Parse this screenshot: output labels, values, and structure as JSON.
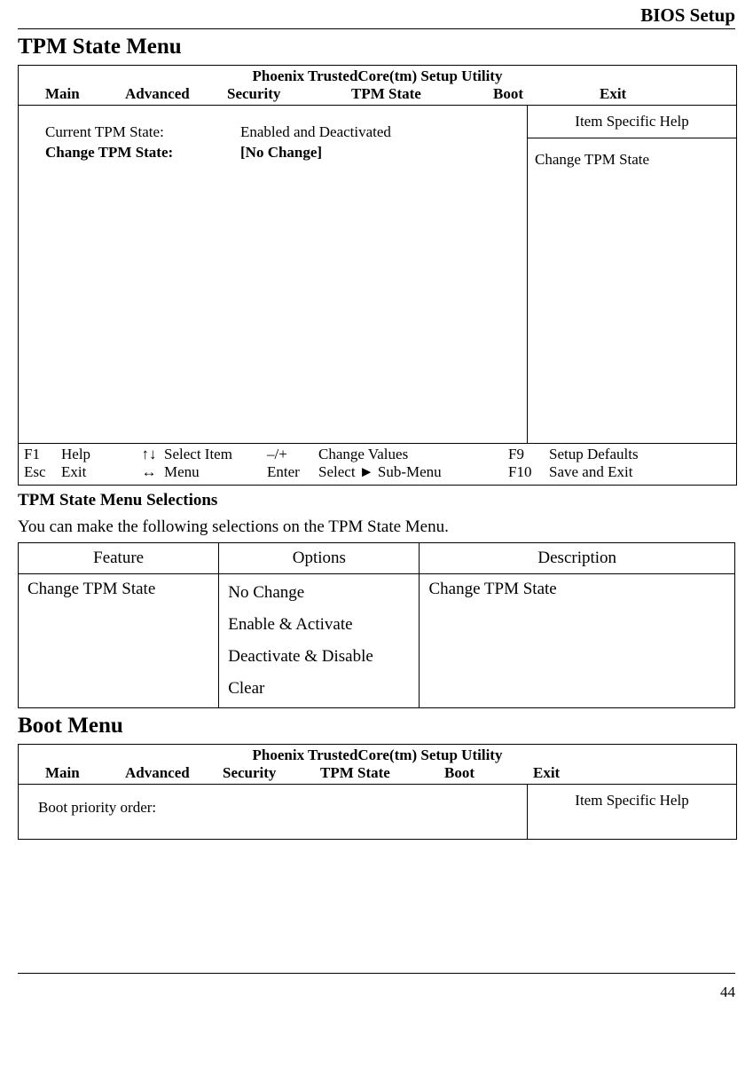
{
  "pageHeader": "BIOS Setup",
  "pageNumber": "44",
  "tpmSection": {
    "title": "TPM State Menu",
    "bios": {
      "title": "Phoenix TrustedCore(tm) Setup Utility",
      "menubar": [
        "Main",
        "Advanced",
        "Security",
        "TPM State",
        "Boot",
        "Exit"
      ],
      "rows": [
        {
          "label": "Current TPM State:",
          "labelBold": false,
          "value": "Enabled and Deactivated",
          "valueBold": false
        },
        {
          "label": "Change TPM State:",
          "labelBold": true,
          "value": "[No Change]",
          "valueBold": true
        }
      ],
      "helpTitle": "Item Specific Help",
      "helpBody": "Change TPM State",
      "footer": {
        "row1": {
          "k1": "F1",
          "a1": "Help",
          "k2": "↑↓",
          "a2": "Select Item",
          "k3": "–/+",
          "a3": "Change Values",
          "k4": "F9",
          "a4": "Setup Defaults"
        },
        "row2": {
          "k1": "Esc",
          "a1": "Exit",
          "k2": "↔",
          "a2": "Menu",
          "k3": "Enter",
          "a3": "Select ► Sub-Menu",
          "k4": "F10",
          "a4": "Save and Exit"
        }
      }
    },
    "selections": {
      "title": "TPM State Menu Selections",
      "intro": "You can make the following selections on the TPM State Menu.",
      "headers": [
        "Feature",
        "Options",
        "Description"
      ],
      "feature": "Change TPM State",
      "options": [
        "No Change",
        "Enable & Activate",
        "Deactivate & Disable",
        "Clear"
      ],
      "description": "Change TPM State"
    }
  },
  "bootSection": {
    "title": "Boot Menu",
    "bios": {
      "title": "Phoenix TrustedCore(tm) Setup Utility",
      "menubar": [
        "Main",
        "Advanced",
        "Security",
        "TPM State",
        "Boot",
        "Exit"
      ],
      "leftText": "Boot priority order:",
      "helpTitle": "Item Specific Help"
    }
  }
}
